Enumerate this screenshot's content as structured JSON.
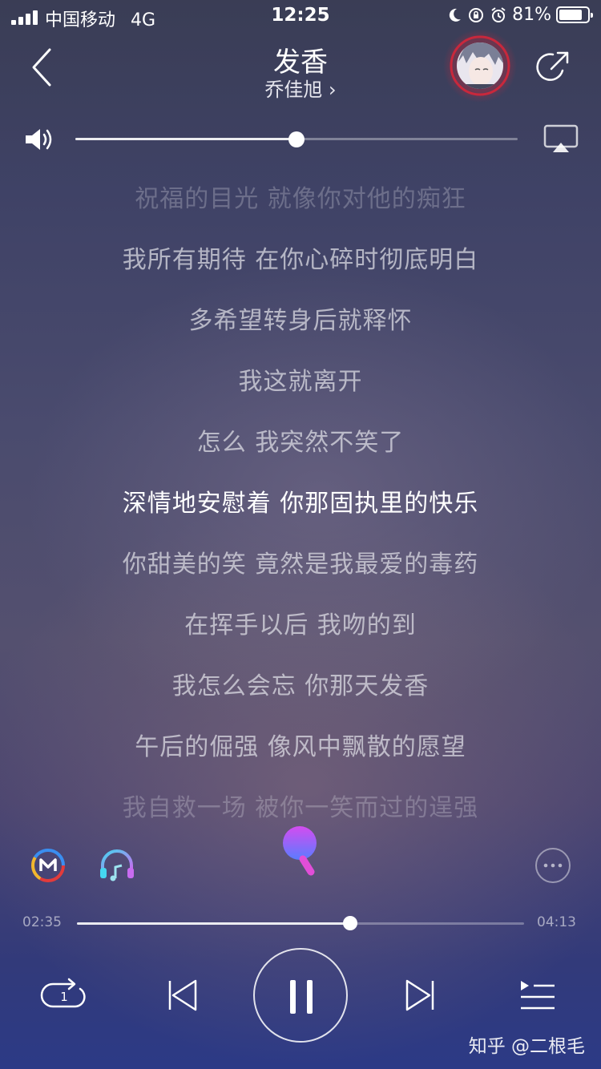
{
  "status_bar": {
    "carrier": "中国移动",
    "network": "4G",
    "time": "12:25",
    "battery_percent": "81%",
    "battery_level": 0.81
  },
  "header": {
    "song_title": "发香",
    "artist": "乔佳旭 ›"
  },
  "volume": {
    "level": 0.5
  },
  "lyrics": [
    {
      "text": "祝福的目光 就像你对他的痴狂",
      "state": "faded"
    },
    {
      "text": "我所有期待 在你心碎时彻底明白",
      "state": "normal"
    },
    {
      "text": "多希望转身后就释怀",
      "state": "normal"
    },
    {
      "text": "我这就离开",
      "state": "normal"
    },
    {
      "text": "怎么 我突然不笑了",
      "state": "normal"
    },
    {
      "text": "深情地安慰着 你那固执里的快乐",
      "state": "current"
    },
    {
      "text": "你甜美的笑 竟然是我最爱的毒药",
      "state": "normal"
    },
    {
      "text": "在挥手以后 我吻的到",
      "state": "normal"
    },
    {
      "text": "我怎么会忘 你那天发香",
      "state": "normal"
    },
    {
      "text": "午后的倔强 像风中飘散的愿望",
      "state": "normal"
    },
    {
      "text": "我自救一场 被你一笑而过的逞强",
      "state": "faded"
    }
  ],
  "playback": {
    "elapsed": "02:35",
    "total": "04:13",
    "progress": 0.612,
    "repeat_badge": "1"
  },
  "watermark": "知乎 @二根毛",
  "colors": {
    "avatar_ring": "#c8283c",
    "mic_top": "#d44cf0",
    "mic_bottom": "#5a7cff",
    "headphone_a": "#45d6f0",
    "headphone_b": "#c86cf0"
  },
  "icons": [
    "back-icon",
    "avatar",
    "share-icon",
    "volume-icon",
    "airplay-icon",
    "m-logo-icon",
    "headphone-effect-icon",
    "karaoke-mic-icon",
    "more-icon",
    "repeat-one-icon",
    "previous-icon",
    "pause-icon",
    "next-icon",
    "playlist-icon"
  ]
}
